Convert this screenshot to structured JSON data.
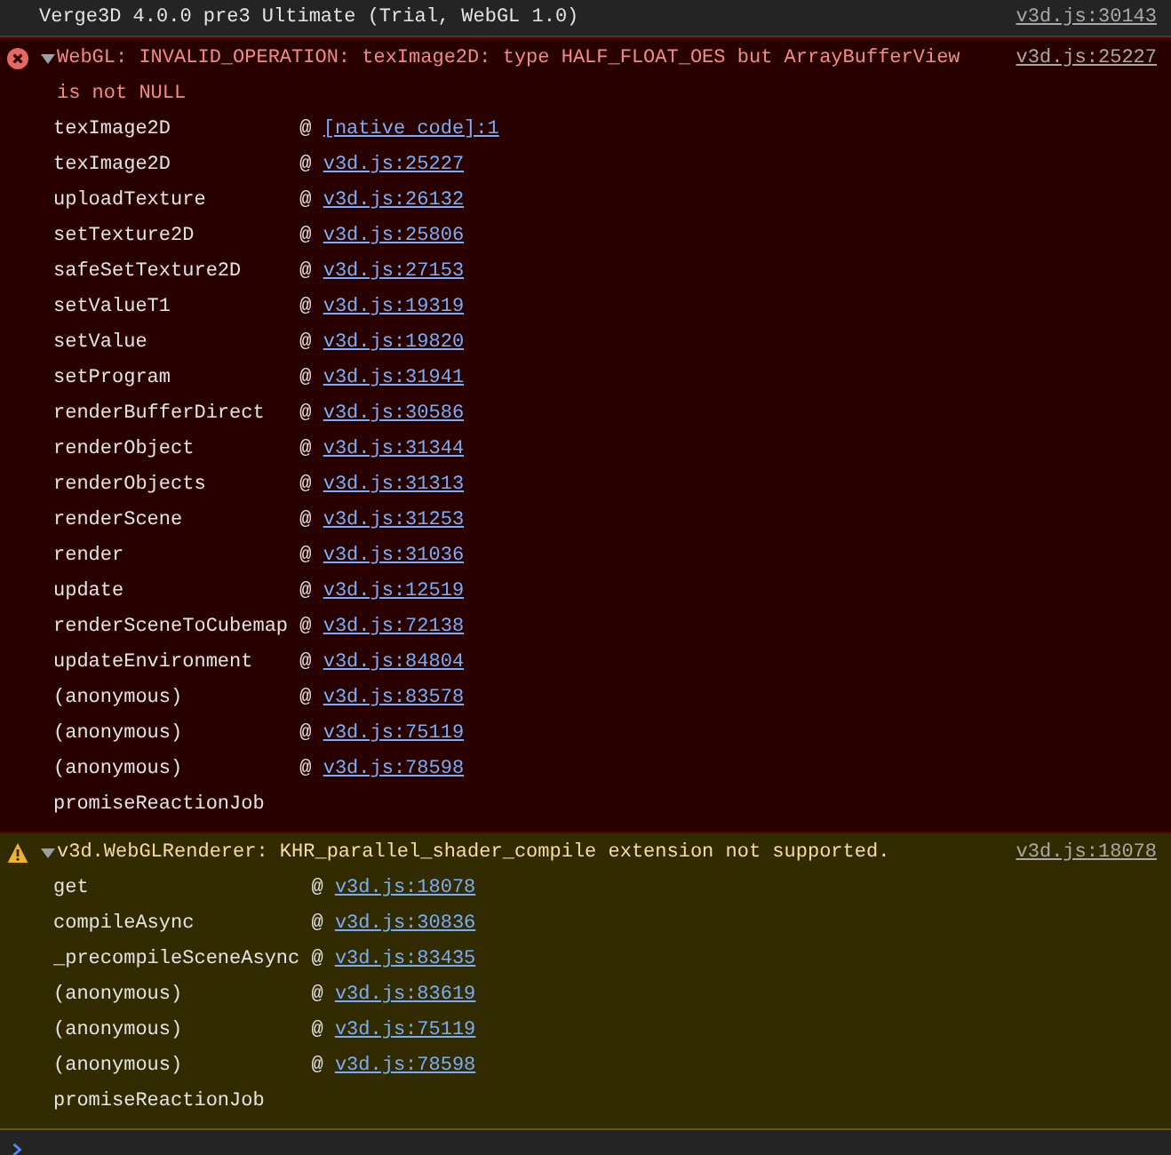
{
  "log": {
    "text": "Verge3D 4.0.0 pre3 Ultimate (Trial, WebGL 1.0)",
    "source": "v3d.js:30143"
  },
  "messages": [
    {
      "kind": "error",
      "expanded": true,
      "text": "WebGL: INVALID_OPERATION: texImage2D: type HALF_FLOAT_OES but ArrayBufferView is not NULL",
      "source": "v3d.js:25227",
      "frames": [
        {
          "function": "texImage2D",
          "at": "@",
          "location": "[native code]:1"
        },
        {
          "function": "texImage2D",
          "at": "@",
          "location": "v3d.js:25227"
        },
        {
          "function": "uploadTexture",
          "at": "@",
          "location": "v3d.js:26132"
        },
        {
          "function": "setTexture2D",
          "at": "@",
          "location": "v3d.js:25806"
        },
        {
          "function": "safeSetTexture2D",
          "at": "@",
          "location": "v3d.js:27153"
        },
        {
          "function": "setValueT1",
          "at": "@",
          "location": "v3d.js:19319"
        },
        {
          "function": "setValue",
          "at": "@",
          "location": "v3d.js:19820"
        },
        {
          "function": "setProgram",
          "at": "@",
          "location": "v3d.js:31941"
        },
        {
          "function": "renderBufferDirect",
          "at": "@",
          "location": "v3d.js:30586"
        },
        {
          "function": "renderObject",
          "at": "@",
          "location": "v3d.js:31344"
        },
        {
          "function": "renderObjects",
          "at": "@",
          "location": "v3d.js:31313"
        },
        {
          "function": "renderScene",
          "at": "@",
          "location": "v3d.js:31253"
        },
        {
          "function": "render",
          "at": "@",
          "location": "v3d.js:31036"
        },
        {
          "function": "update",
          "at": "@",
          "location": "v3d.js:12519"
        },
        {
          "function": "renderSceneToCubemap",
          "at": "@",
          "location": "v3d.js:72138"
        },
        {
          "function": "updateEnvironment",
          "at": "@",
          "location": "v3d.js:84804"
        },
        {
          "function": "(anonymous)",
          "at": "@",
          "location": "v3d.js:83578"
        },
        {
          "function": "(anonymous)",
          "at": "@",
          "location": "v3d.js:75119"
        },
        {
          "function": "(anonymous)",
          "at": "@",
          "location": "v3d.js:78598"
        },
        {
          "function": "promiseReactionJob"
        }
      ]
    },
    {
      "kind": "warning",
      "expanded": true,
      "text": "v3d.WebGLRenderer: KHR_parallel_shader_compile extension not supported.",
      "source": "v3d.js:18078",
      "frames": [
        {
          "function": "get",
          "at": "@",
          "location": "v3d.js:18078"
        },
        {
          "function": "compileAsync",
          "at": "@",
          "location": "v3d.js:30836"
        },
        {
          "function": "_precompileSceneAsync",
          "at": "@",
          "location": "v3d.js:83435"
        },
        {
          "function": "(anonymous)",
          "at": "@",
          "location": "v3d.js:83619"
        },
        {
          "function": "(anonymous)",
          "at": "@",
          "location": "v3d.js:75119"
        },
        {
          "function": "(anonymous)",
          "at": "@",
          "location": "v3d.js:78598"
        },
        {
          "function": "promiseReactionJob"
        }
      ]
    }
  ]
}
